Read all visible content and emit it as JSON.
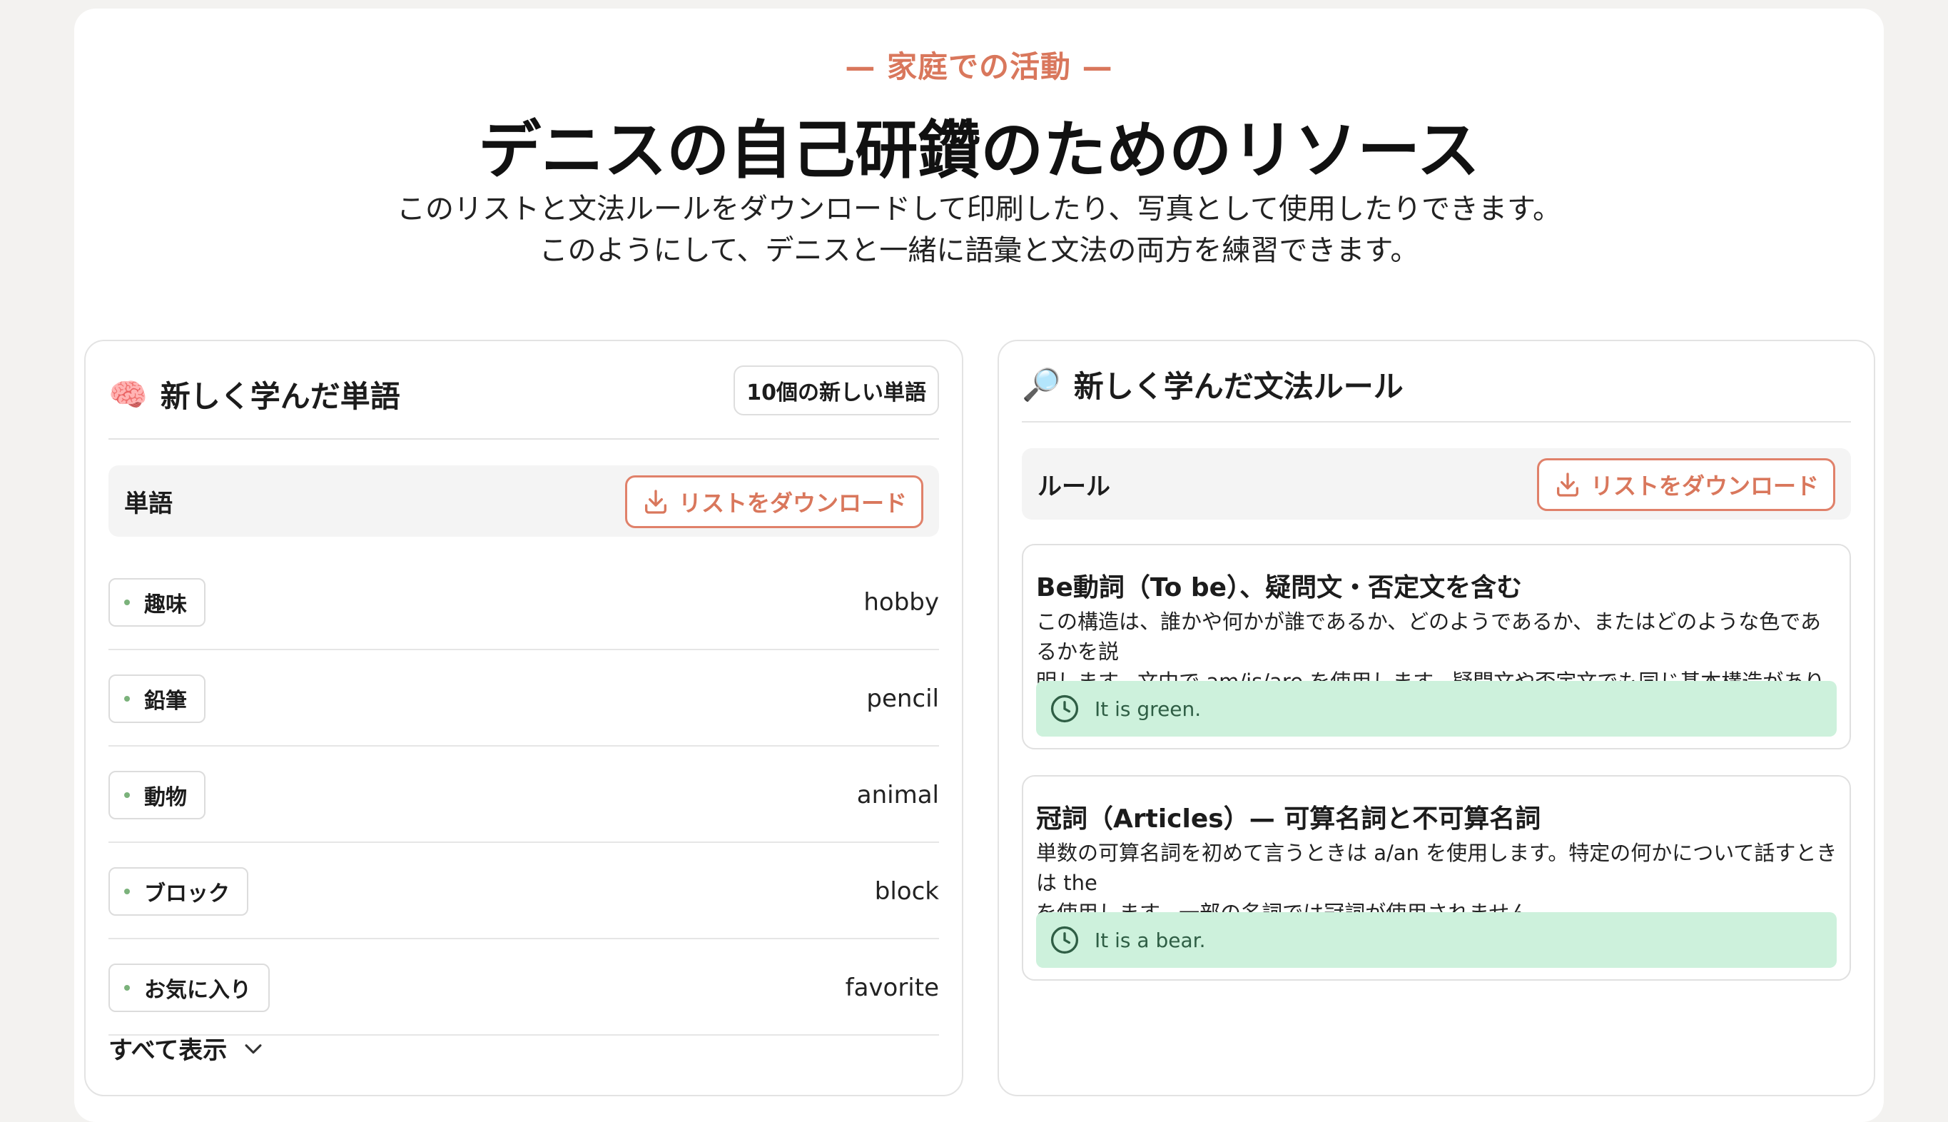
{
  "header": {
    "eyebrow": "— 家庭での活動 —",
    "title": "デニスの自己研鑽のためのリソース",
    "subtitle_line1": "このリストと文法ルールをダウンロードして印刷したり、写真として使用したりできます。",
    "subtitle_line2": "このようにして、デニスと一緒に語彙と文法の両方を練習できます。"
  },
  "words_card": {
    "icon": "brain-icon",
    "emoji": "🧠",
    "title": "新しく学んだ単語",
    "count_badge": "10個の新しい単語",
    "table_header": "単語",
    "download_label": "リストをダウンロード",
    "items": [
      {
        "word": "趣味",
        "translation": "hobby"
      },
      {
        "word": "鉛筆",
        "translation": "pencil"
      },
      {
        "word": "動物",
        "translation": "animal"
      },
      {
        "word": "ブロック",
        "translation": "block"
      },
      {
        "word": "お気に入り",
        "translation": "favorite"
      }
    ],
    "show_all_label": "すべて表示"
  },
  "grammar_card": {
    "icon": "magnifier-icon",
    "emoji": "🔎",
    "title": "新しく学んだ文法ルール",
    "table_header": "ルール",
    "download_label": "リストをダウンロード",
    "rules": [
      {
        "title": "Be動詞（To be）、疑問文・否定文を含む",
        "desc_line1": "この構造は、誰かや何かが誰であるか、どのようであるか、またはどのような色であるかを説",
        "desc_line2": "明します。文中で am/is/are を使用します。疑問文や否定文でも同じ基本構造があります。",
        "example": "It is green."
      },
      {
        "title": "冠詞（Articles）— 可算名詞と不可算名詞",
        "desc_line1": "単数の可算名詞を初めて言うときは a/an を使用します。特定の何かについて話すときは the",
        "desc_line2": "を使用します。一部の名詞では冠詞が使用されません。",
        "example": "It is a bear."
      }
    ]
  },
  "colors": {
    "accent": "#d9775c",
    "example_bg": "#cdf1dc",
    "example_text": "#2f5e45",
    "dot": "#7bb27b"
  }
}
